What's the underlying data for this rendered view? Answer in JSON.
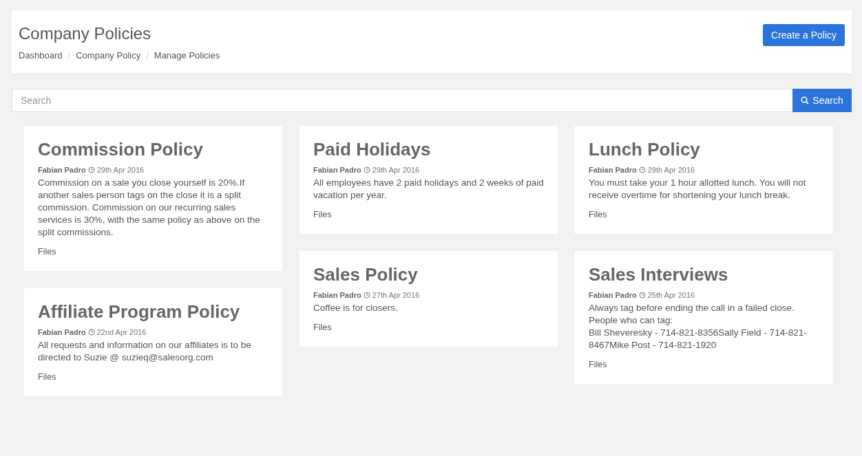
{
  "header": {
    "title": "Company Policies",
    "breadcrumb": [
      "Dashboard",
      "Company Policy",
      "Manage Policies"
    ],
    "breadcrumb_separator": "/",
    "create_button": "Create a Policy"
  },
  "search": {
    "placeholder": "Search",
    "button": "Search"
  },
  "columns": [
    [
      {
        "title": "Commission Policy",
        "author": "Fabian Padro",
        "date": "29th Apr 2016",
        "body": [
          "Commission on a sale you close yourself is 20%.If another sales person tags on the close it is a split commission. Commission on our recurring sales services is 30%, with the same policy as above on the split commissions."
        ],
        "files": "Files"
      },
      {
        "title": "Affiliate Program Policy",
        "author": "Fabian Padro",
        "date": "22nd Apr 2016",
        "body": [
          "All requests and information on our affiliates is to be directed to Suzie @ suzieq@salesorg.com"
        ],
        "files": "Files"
      }
    ],
    [
      {
        "title": "Paid Holidays",
        "author": "Fabian Padro",
        "date": "29th Apr 2016",
        "body": [
          "All employees have 2 paid holidays and 2 weeks of paid vacation per year."
        ],
        "files": "Files"
      },
      {
        "title": "Sales Policy",
        "author": "Fabian Padro",
        "date": "27th Apr 2016",
        "body": [
          "Coffee is for closers."
        ],
        "files": "Files"
      }
    ],
    [
      {
        "title": "Lunch Policy",
        "author": "Fabian Padro",
        "date": "29th Apr 2016",
        "body": [
          "You must take your 1 hour allotted lunch. You will not receive overtime for shortening your lunch break."
        ],
        "files": "Files"
      },
      {
        "title": "Sales Interviews",
        "author": "Fabian Padro",
        "date": "25th Apr 2016",
        "body": [
          "Always tag before ending the call in a failed close.",
          "People who can tag:",
          "Bill Sheveresky - 714-821-8356Sally Field - 714-821-8467Mike Post - 714-821-1920"
        ],
        "files": "Files"
      }
    ]
  ]
}
